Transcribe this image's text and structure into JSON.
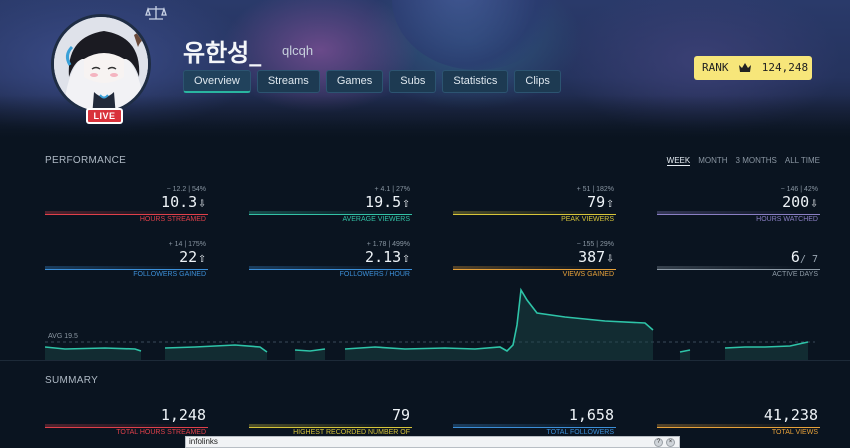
{
  "profile": {
    "name": "유한성_",
    "handle": "qlcqh",
    "live_label": "LIVE"
  },
  "nav": {
    "tabs": [
      "Overview",
      "Streams",
      "Games",
      "Subs",
      "Statistics",
      "Clips"
    ],
    "active_tab": "Overview"
  },
  "rank": {
    "label": "RANK",
    "value": "124,248"
  },
  "performance": {
    "title": "PERFORMANCE",
    "ranges": [
      "WEEK",
      "MONTH",
      "3 MONTHS",
      "ALL TIME"
    ],
    "active_range": "WEEK",
    "stats": [
      {
        "label": "HOURS STREAMED",
        "value": "10.3",
        "arrow": "⇩",
        "delta": "− 12.2 | 54%",
        "color": "#e0404a"
      },
      {
        "label": "AVERAGE VIEWERS",
        "value": "19.5",
        "arrow": "⇧",
        "delta": "+ 4.1 | 27%",
        "color": "#33c2a6"
      },
      {
        "label": "PEAK VIEWERS",
        "value": "79",
        "arrow": "⇧",
        "delta": "+ 51 | 182%",
        "color": "#d7c53a"
      },
      {
        "label": "HOURS WATCHED",
        "value": "200",
        "arrow": "⇩",
        "delta": "− 146 | 42%",
        "color": "#8a7fc4"
      },
      {
        "label": "FOLLOWERS GAINED",
        "value": "22",
        "arrow": "⇧",
        "delta": "+ 14 | 175%",
        "color": "#3c8fd8"
      },
      {
        "label": "FOLLOWERS / HOUR",
        "value": "2.13",
        "arrow": "⇧",
        "delta": "+ 1.78 | 499%",
        "color": "#3c8fd8"
      },
      {
        "label": "VIEWS GAINED",
        "value": "387",
        "arrow": "⇩",
        "delta": "− 155 | 29%",
        "color": "#e8a23a"
      },
      {
        "label": "ACTIVE DAYS",
        "value": "6",
        "sub": "/ 7",
        "arrow": "",
        "delta": "",
        "color": "#8f9ca8"
      }
    ],
    "avg_label": "AVG 19.5"
  },
  "summary": {
    "title": "SUMMARY",
    "stats": [
      {
        "label": "TOTAL HOURS STREAMED",
        "value": "1,248",
        "color": "#e0404a"
      },
      {
        "label": "HIGHEST RECORDED NUMBER OF",
        "value": "79",
        "color": "#d7c53a"
      },
      {
        "label": "TOTAL FOLLOWERS",
        "value": "1,658",
        "color": "#3c8fd8"
      },
      {
        "label": "TOTAL VIEWS",
        "value": "41,238",
        "color": "#e8a23a"
      }
    ]
  },
  "ad": {
    "label": "infolinks"
  },
  "colors": {
    "accent": "#2ab5a0",
    "rank_bg": "#f7e67a",
    "live": "#d9323b"
  }
}
